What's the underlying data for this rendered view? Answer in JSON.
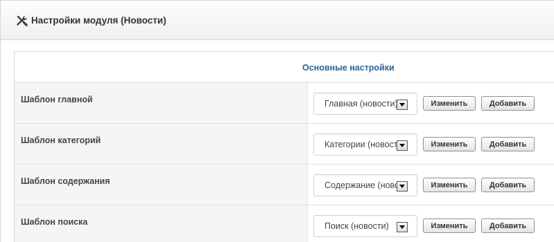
{
  "header": {
    "title": "Настройки модуля (Новости)",
    "icon": "tools-icon"
  },
  "section": {
    "title": "Основные настройки"
  },
  "rows": [
    {
      "label": "Шаблон главной",
      "select_value": "Главная (новости)",
      "edit_label": "Изменить",
      "add_label": "Добавить"
    },
    {
      "label": "Шаблон категорий",
      "select_value": "Категории (новости)",
      "edit_label": "Изменить",
      "add_label": "Добавить"
    },
    {
      "label": "Шаблон содержания",
      "select_value": "Содержание (новости)",
      "edit_label": "Изменить",
      "add_label": "Добавить"
    },
    {
      "label": "Шаблон поиска",
      "select_value": "Поиск (новости)",
      "edit_label": "Изменить",
      "add_label": "Добавить"
    }
  ],
  "colors": {
    "section_title": "#2a6496",
    "label_bg": "#f5f5f5"
  }
}
